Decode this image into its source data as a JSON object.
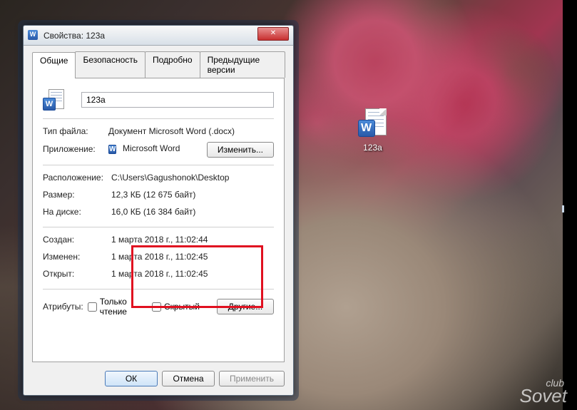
{
  "desktop": {
    "file_icon_label": "123а"
  },
  "dialog": {
    "title": "Свойства: 123а",
    "tabs": {
      "general": "Общие",
      "security": "Безопасность",
      "details": "Подробно",
      "previous": "Предыдущие версии"
    },
    "filename": "123а",
    "rows": {
      "filetype_label": "Тип файла:",
      "filetype_value": "Документ Microsoft Word (.docx)",
      "app_label": "Приложение:",
      "app_value": "Microsoft Word",
      "change_btn": "Изменить...",
      "location_label": "Расположение:",
      "location_value": "C:\\Users\\Gagushonok\\Desktop",
      "size_label": "Размер:",
      "size_value": "12,3 КБ (12 675 байт)",
      "ondisk_label": "На диске:",
      "ondisk_value": "16,0 КБ (16 384 байт)",
      "created_label": "Создан:",
      "created_value": "1 марта 2018 г., 11:02:44",
      "modified_label": "Изменен:",
      "modified_value": "1 марта 2018 г., 11:02:45",
      "accessed_label": "Открыт:",
      "accessed_value": "1 марта 2018 г., 11:02:45",
      "attrib_label": "Атрибуты:",
      "readonly_label": "Только чтение",
      "hidden_label": "Скрытый",
      "other_btn": "Другие..."
    },
    "footer": {
      "ok": "ОК",
      "cancel": "Отмена",
      "apply": "Применить"
    }
  },
  "watermark": {
    "line1": "club",
    "line2": "Sovet"
  }
}
